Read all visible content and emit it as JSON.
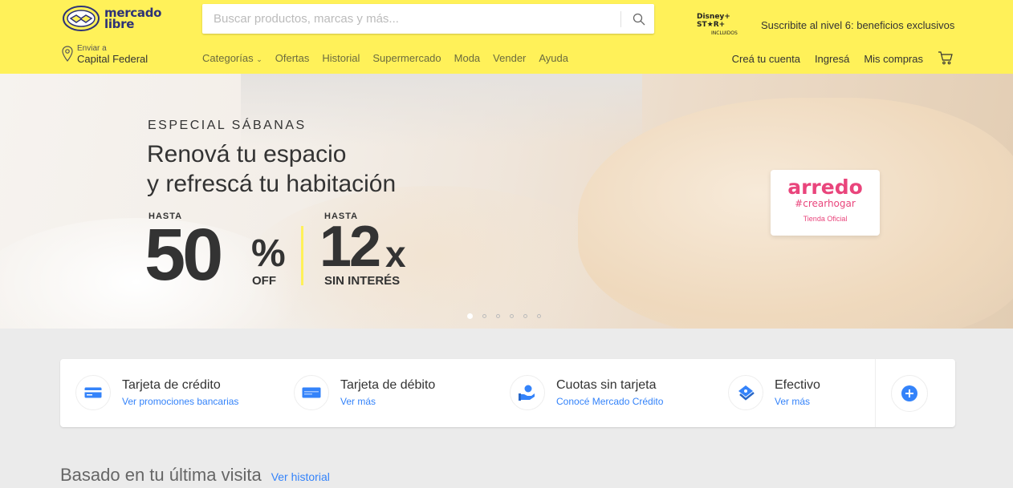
{
  "header": {
    "logo": {
      "line1": "mercado",
      "line2": "libre"
    },
    "search": {
      "placeholder": "Buscar productos, marcas y más..."
    },
    "promo": {
      "brand_line1": "Disney+ ST★R+",
      "brand_line2": "INCLUIDOS",
      "text": "Suscribite al nivel 6: beneficios exclusivos"
    },
    "location": {
      "label": "Enviar a",
      "value": "Capital Federal"
    },
    "nav": [
      "Categorías",
      "Ofertas",
      "Historial",
      "Supermercado",
      "Moda",
      "Vender",
      "Ayuda"
    ],
    "account": [
      "Creá tu cuenta",
      "Ingresá",
      "Mis compras"
    ],
    "brand_color": "#fff159"
  },
  "hero": {
    "eyebrow": "ESPECIAL SÁBANAS",
    "title_line1": "Renová tu espacio",
    "title_line2": "y refrescá tu habitación",
    "discount": {
      "label": "HASTA",
      "value": "50",
      "unit": "%",
      "suffix": "OFF"
    },
    "installments": {
      "label": "HASTA",
      "value": "12",
      "unit": "x",
      "suffix": "SIN INTERÉS"
    },
    "badge": {
      "name": "arredo",
      "tag": "#crearhogar",
      "caption": "Tienda Oficial"
    },
    "slides": 6,
    "active_slide": 1
  },
  "payments": [
    {
      "title": "Tarjeta de crédito",
      "link": "Ver promociones bancarias",
      "icon": "credit-card-icon"
    },
    {
      "title": "Tarjeta de débito",
      "link": "Ver más",
      "icon": "debit-card-icon"
    },
    {
      "title": "Cuotas sin tarjeta",
      "link": "Conocé Mercado Crédito",
      "icon": "hand-coin-icon"
    },
    {
      "title": "Efectivo",
      "link": "Ver más",
      "icon": "cash-icon"
    }
  ],
  "section": {
    "title": "Basado en tu última visita",
    "link": "Ver historial"
  },
  "colors": {
    "link": "#3483fa",
    "arredo": "#e9457c"
  }
}
